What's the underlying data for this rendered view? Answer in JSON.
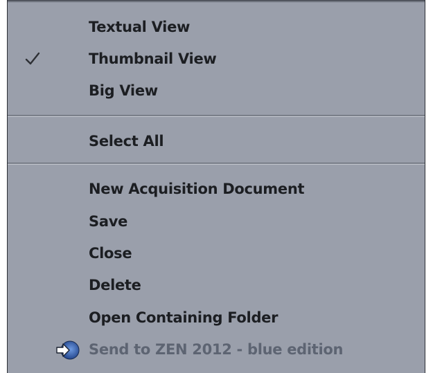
{
  "menu": {
    "view_items": [
      {
        "label": "Textual View",
        "checked": false
      },
      {
        "label": "Thumbnail View",
        "checked": true
      },
      {
        "label": "Big View",
        "checked": false
      }
    ],
    "select_all": "Select All",
    "actions": [
      {
        "label": "New Acquisition Document"
      },
      {
        "label": "Save"
      },
      {
        "label": "Close"
      },
      {
        "label": "Delete"
      },
      {
        "label": "Open Containing Folder"
      }
    ],
    "send_to": {
      "label": "Send to ZEN 2012 - blue edition",
      "enabled": false,
      "icon": "zen-blue-arrow-icon"
    }
  },
  "colors": {
    "menu_background": "#9a9fab",
    "text": "#1c1e22",
    "disabled_text": "#5d6472",
    "icon_blue": "#2f5fb0"
  }
}
